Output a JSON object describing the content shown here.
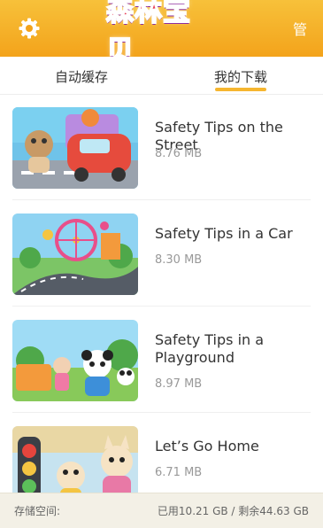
{
  "header": {
    "logo_text": "森林宝贝",
    "manage_label": "管"
  },
  "tabs": [
    {
      "label": "自动缓存",
      "active": false
    },
    {
      "label": "我的下载",
      "active": true
    }
  ],
  "downloads": [
    {
      "title": "Safety Tips on the Street",
      "size": "8.76 MB"
    },
    {
      "title": "Safety Tips in a Car",
      "size": "8.30 MB"
    },
    {
      "title": "Safety Tips in a Playground",
      "size": "8.97 MB"
    },
    {
      "title": "Let’s Go Home",
      "size": "6.71 MB"
    }
  ],
  "storage": {
    "label": "存储空间:",
    "value": "已用10.21 GB / 剩余44.63 GB"
  },
  "colors": {
    "accent": "#f3a31b",
    "tab_underline": "#f6b630"
  }
}
